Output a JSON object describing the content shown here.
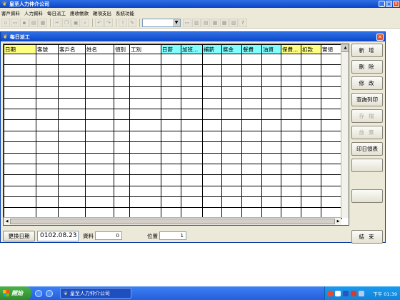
{
  "app": {
    "title": "皇至人力仲介公司",
    "window_buttons": [
      "_",
      "□",
      "✕"
    ]
  },
  "menu": [
    "客戶資料",
    "人力資料",
    "每日派工",
    "應收帳款",
    "雜項支出",
    "系統功能"
  ],
  "toolbar": {
    "combo_value": ""
  },
  "child": {
    "title": "每日派工",
    "columns": [
      "日期",
      "客號",
      "客戶名",
      "姓名",
      "領別",
      "工別",
      "日薪",
      "加班...",
      "補薪",
      "獎金",
      "餐費",
      "油資",
      "保費...",
      "扣款",
      "實領"
    ],
    "buttons": [
      "新增",
      "刪除",
      "修改",
      "查詢列印",
      "存檔",
      "放棄",
      "印日領表",
      "",
      "",
      "結束"
    ],
    "bottom": {
      "change_date_label": "更換日期",
      "date_value": "0102.08.23",
      "count_label": "資料",
      "count_value": "0",
      "pos_label": "位置",
      "pos_value": "1"
    }
  },
  "taskbar": {
    "start_label": "開始",
    "task_label": "皇至人力仲介公司",
    "clock": "下午 01:39"
  },
  "colors": {
    "header_yellow": "#ffff80",
    "header_cyan": "#80ffff",
    "title_blue": "#0a46c8"
  }
}
